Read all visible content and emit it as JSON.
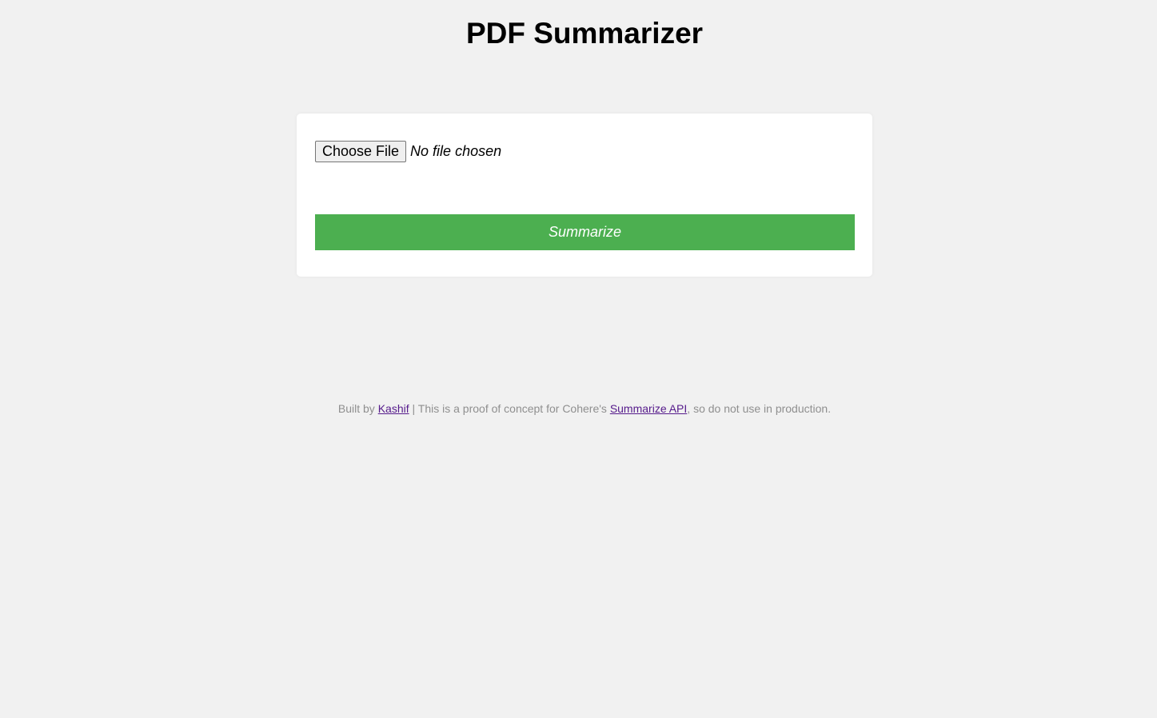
{
  "header": {
    "title": "PDF Summarizer"
  },
  "form": {
    "choose_file_label": "Choose File",
    "file_status": "No file chosen",
    "submit_label": "Summarize"
  },
  "footer": {
    "prefix": "Built by ",
    "author_link": "Kashif",
    "middle": " | This is a proof of concept for Cohere's ",
    "api_link": "Summarize API",
    "suffix": ", so do not use in production."
  },
  "colors": {
    "background": "#f1f1f1",
    "card": "#ffffff",
    "accent": "#4caf50",
    "footer_text": "#8f8f8f",
    "visited_link": "#551a8b"
  }
}
